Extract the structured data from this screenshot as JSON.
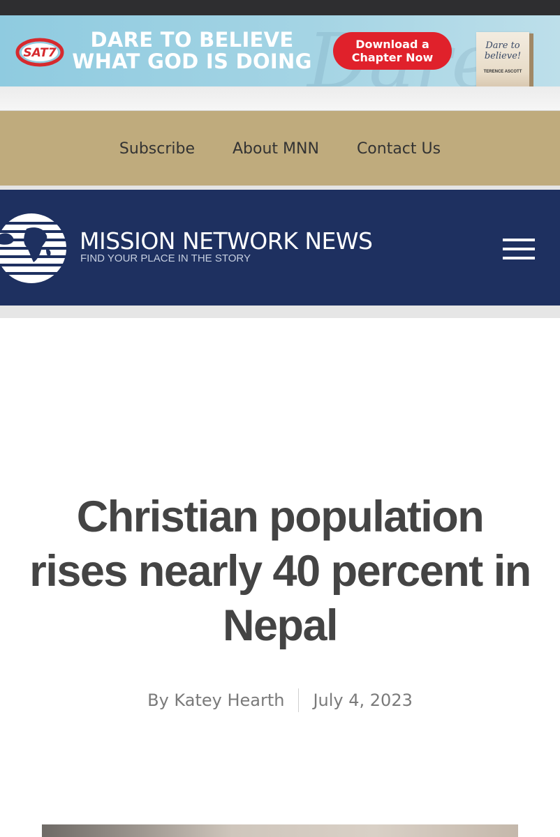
{
  "ad": {
    "logo_text": "SAT7",
    "headline_line1": "DARE TO BELIEVE",
    "headline_line2": "WHAT GOD IS DOING",
    "cta_line1": "Download a",
    "cta_line2": "Chapter Now",
    "book_title": "Dare to believe!",
    "book_author": "TERENCE ASCOTT",
    "watermark": "Dare"
  },
  "nav": {
    "links": [
      "Subscribe",
      "About MNN",
      "Contact Us"
    ]
  },
  "brand": {
    "name": "MISSION NETWORK NEWS",
    "tagline": "FIND YOUR PLACE IN THE STORY"
  },
  "article": {
    "title": "Christian population rises nearly 40 percent in Nepal",
    "author": "By Katey Hearth",
    "date": "July 4, 2023"
  },
  "colors": {
    "ad_cta": "#e0212b",
    "nav_bg": "#bfab7d",
    "brand_bg": "#1e3060",
    "title_text": "#444444"
  }
}
